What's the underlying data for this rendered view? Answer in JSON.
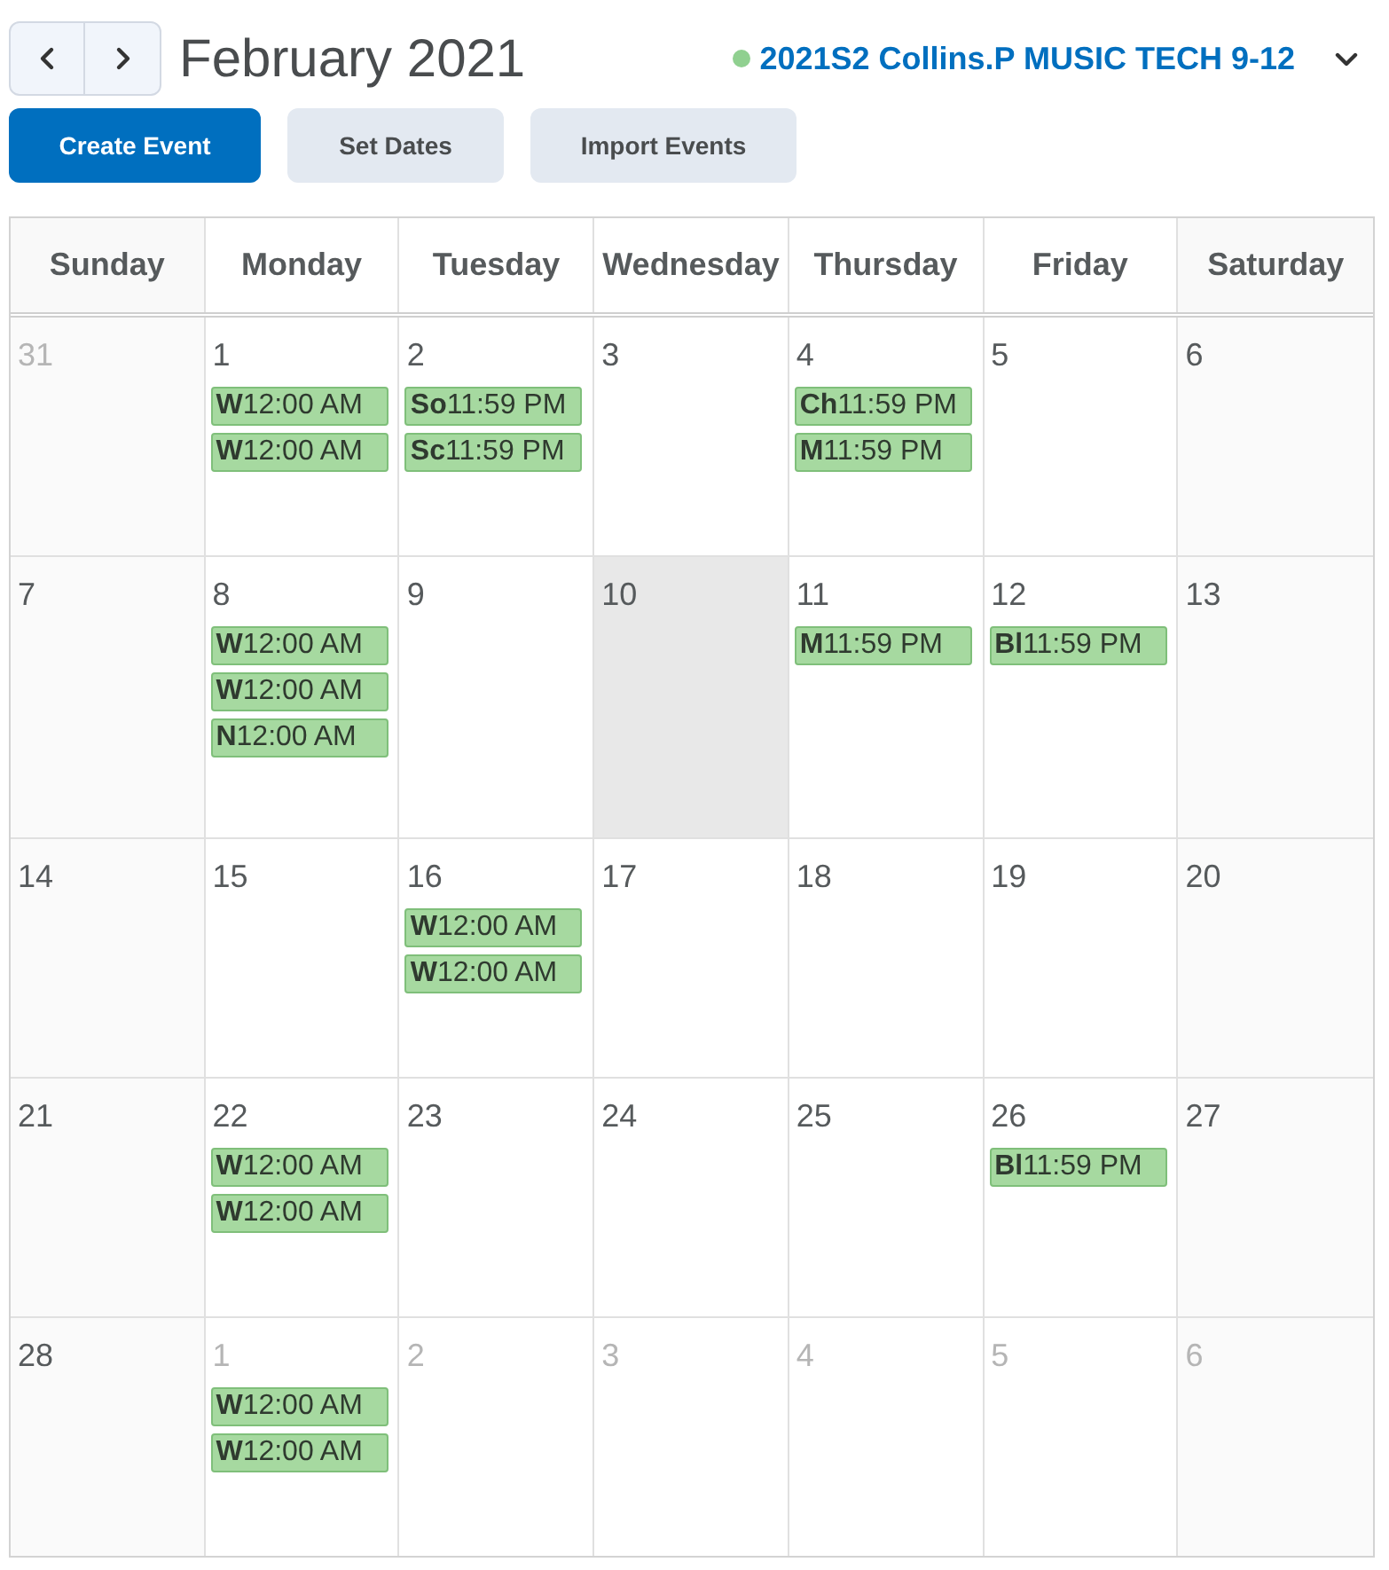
{
  "header": {
    "title": "February 2021",
    "course": "2021S2 Collins.P MUSIC TECH 9-12"
  },
  "buttons": [
    {
      "label": "Create Event",
      "kind": "primary"
    },
    {
      "label": "Set Dates",
      "kind": "secondary"
    },
    {
      "label": "Import Events",
      "kind": "secondary"
    }
  ],
  "weekdays": [
    "Sunday",
    "Monday",
    "Tuesday",
    "Wednesday",
    "Thursday",
    "Friday",
    "Saturday"
  ],
  "weeks": [
    {
      "days": [
        {
          "date": "31",
          "outside": true,
          "today": false
        },
        {
          "date": "1",
          "outside": false,
          "today": false,
          "events": [
            {
              "title": "W",
              "time": "12:00 AM"
            },
            {
              "title": "W",
              "time": "12:00 AM"
            }
          ]
        },
        {
          "date": "2",
          "outside": false,
          "today": false,
          "events": [
            {
              "title": "So",
              "time": "11:59 PM"
            },
            {
              "title": "Sc",
              "time": "11:59 PM"
            }
          ]
        },
        {
          "date": "3",
          "outside": false,
          "today": false
        },
        {
          "date": "4",
          "outside": false,
          "today": false,
          "events": [
            {
              "title": "Ch",
              "time": "11:59 PM"
            },
            {
              "title": "M",
              "time": "11:59 PM"
            }
          ]
        },
        {
          "date": "5",
          "outside": false,
          "today": false
        },
        {
          "date": "6",
          "outside": false,
          "today": false
        }
      ]
    },
    {
      "days": [
        {
          "date": "7",
          "outside": false,
          "today": false
        },
        {
          "date": "8",
          "outside": false,
          "today": false,
          "events": [
            {
              "title": "W",
              "time": "12:00 AM"
            },
            {
              "title": "W",
              "time": "12:00 AM"
            },
            {
              "title": "N",
              "time": "12:00 AM"
            }
          ]
        },
        {
          "date": "9",
          "outside": false,
          "today": false
        },
        {
          "date": "10",
          "outside": false,
          "today": true
        },
        {
          "date": "11",
          "outside": false,
          "today": false,
          "events": [
            {
              "title": "M",
              "time": "11:59 PM"
            }
          ]
        },
        {
          "date": "12",
          "outside": false,
          "today": false,
          "events": [
            {
              "title": "Bl",
              "time": "11:59 PM"
            }
          ]
        },
        {
          "date": "13",
          "outside": false,
          "today": false
        }
      ]
    },
    {
      "days": [
        {
          "date": "14",
          "outside": false,
          "today": false
        },
        {
          "date": "15",
          "outside": false,
          "today": false
        },
        {
          "date": "16",
          "outside": false,
          "today": false,
          "events": [
            {
              "title": "W",
              "time": "12:00 AM"
            },
            {
              "title": "W",
              "time": "12:00 AM"
            }
          ]
        },
        {
          "date": "17",
          "outside": false,
          "today": false
        },
        {
          "date": "18",
          "outside": false,
          "today": false
        },
        {
          "date": "19",
          "outside": false,
          "today": false
        },
        {
          "date": "20",
          "outside": false,
          "today": false
        }
      ]
    },
    {
      "days": [
        {
          "date": "21",
          "outside": false,
          "today": false
        },
        {
          "date": "22",
          "outside": false,
          "today": false,
          "events": [
            {
              "title": "W",
              "time": "12:00 AM"
            },
            {
              "title": "W",
              "time": "12:00 AM"
            }
          ]
        },
        {
          "date": "23",
          "outside": false,
          "today": false
        },
        {
          "date": "24",
          "outside": false,
          "today": false
        },
        {
          "date": "25",
          "outside": false,
          "today": false
        },
        {
          "date": "26",
          "outside": false,
          "today": false,
          "events": [
            {
              "title": "Bl",
              "time": "11:59 PM"
            }
          ]
        },
        {
          "date": "27",
          "outside": false,
          "today": false
        }
      ]
    },
    {
      "days": [
        {
          "date": "28",
          "outside": false,
          "today": false
        },
        {
          "date": "1",
          "outside": true,
          "today": false,
          "events": [
            {
              "title": "W",
              "time": "12:00 AM"
            },
            {
              "title": "W",
              "time": "12:00 AM"
            }
          ]
        },
        {
          "date": "2",
          "outside": true,
          "today": false
        },
        {
          "date": "3",
          "outside": true,
          "today": false
        },
        {
          "date": "4",
          "outside": true,
          "today": false
        },
        {
          "date": "5",
          "outside": true,
          "today": false
        },
        {
          "date": "6",
          "outside": true,
          "today": false
        }
      ]
    }
  ]
}
